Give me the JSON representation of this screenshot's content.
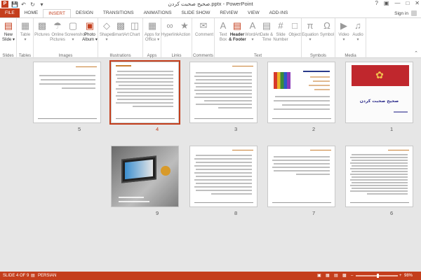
{
  "app": {
    "title": "صحیح صحبت کردن.pptx - PowerPoint",
    "signin": "Sign in",
    "help": "?"
  },
  "tabs": [
    "FILE",
    "HOME",
    "INSERT",
    "DESIGN",
    "TRANSITIONS",
    "ANIMATIONS",
    "SLIDE SHOW",
    "REVIEW",
    "VIEW",
    "ADD-INS"
  ],
  "active_tab": "INSERT",
  "ribbon": {
    "groups": [
      {
        "label": "Slides",
        "commands": [
          {
            "label": "New\nSlide ▾",
            "icon": "new-slide-icon"
          }
        ]
      },
      {
        "label": "Tables",
        "commands": [
          {
            "label": "Table\n▾",
            "icon": "table-icon"
          }
        ]
      },
      {
        "label": "Images",
        "commands": [
          {
            "label": "Pictures",
            "icon": "pictures-icon"
          },
          {
            "label": "Online\nPictures",
            "icon": "online-pictures-icon"
          },
          {
            "label": "Screenshot\n▾",
            "icon": "screenshot-icon"
          },
          {
            "label": "Photo\nAlbum ▾",
            "icon": "photo-album-icon"
          }
        ]
      },
      {
        "label": "Illustrations",
        "commands": [
          {
            "label": "Shapes\n▾",
            "icon": "shapes-icon"
          },
          {
            "label": "SmartArt",
            "icon": "smartart-icon"
          },
          {
            "label": "Chart",
            "icon": "chart-icon"
          }
        ]
      },
      {
        "label": "Apps",
        "commands": [
          {
            "label": "Apps for\nOffice ▾",
            "icon": "apps-icon"
          }
        ]
      },
      {
        "label": "Links",
        "commands": [
          {
            "label": "Hyperlink",
            "icon": "hyperlink-icon"
          },
          {
            "label": "Action",
            "icon": "action-icon"
          }
        ]
      },
      {
        "label": "Comments",
        "commands": [
          {
            "label": "Comment",
            "icon": "comment-icon"
          }
        ]
      },
      {
        "label": "Text",
        "commands": [
          {
            "label": "Text\nBox",
            "icon": "textbox-icon"
          },
          {
            "label": "Header\n& Footer",
            "icon": "header-footer-icon"
          },
          {
            "label": "WordArt\n▾",
            "icon": "wordart-icon"
          },
          {
            "label": "Date &\nTime",
            "icon": "date-time-icon"
          },
          {
            "label": "Slide\nNumber",
            "icon": "slide-number-icon"
          },
          {
            "label": "Object",
            "icon": "object-icon"
          }
        ]
      },
      {
        "label": "Symbols",
        "commands": [
          {
            "label": "Equation\n▾",
            "icon": "equation-icon"
          },
          {
            "label": "Symbol",
            "icon": "symbol-icon"
          }
        ]
      },
      {
        "label": "Media",
        "commands": [
          {
            "label": "Video\n▾",
            "icon": "video-icon"
          },
          {
            "label": "Audio\n▾",
            "icon": "audio-icon"
          }
        ]
      }
    ]
  },
  "slides": [
    {
      "number": "5"
    },
    {
      "number": "4"
    },
    {
      "number": "3"
    },
    {
      "number": "2"
    },
    {
      "number": "1"
    },
    {
      "number": "9"
    },
    {
      "number": "8"
    },
    {
      "number": "7"
    },
    {
      "number": "6"
    }
  ],
  "slide1": {
    "title": "صحیح صحبت کردن"
  },
  "status": {
    "slide_of": "SLIDE 4 OF 9",
    "language": "PERSIAN",
    "zoom": "98%"
  },
  "colors": {
    "accent": "#c43e1c",
    "header_line": "#c87f33"
  }
}
